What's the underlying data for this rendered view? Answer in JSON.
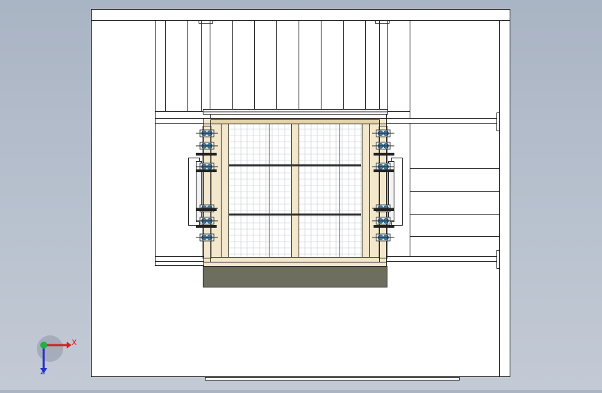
{
  "view_triad": {
    "x_label": "X",
    "y_label": "Z",
    "colors": {
      "x": "#d42020",
      "up": "#22b040",
      "z": "#2233cc"
    }
  },
  "colors": {
    "viewport_background": "#b0bac8",
    "paper": "#ffffff",
    "outline": "#222222",
    "frame_wood": "#f3e8cc",
    "frame_wood_dark": "#e6d3a8",
    "base_block": "#6d6d60",
    "roller_blue": "#3a7ea8"
  }
}
